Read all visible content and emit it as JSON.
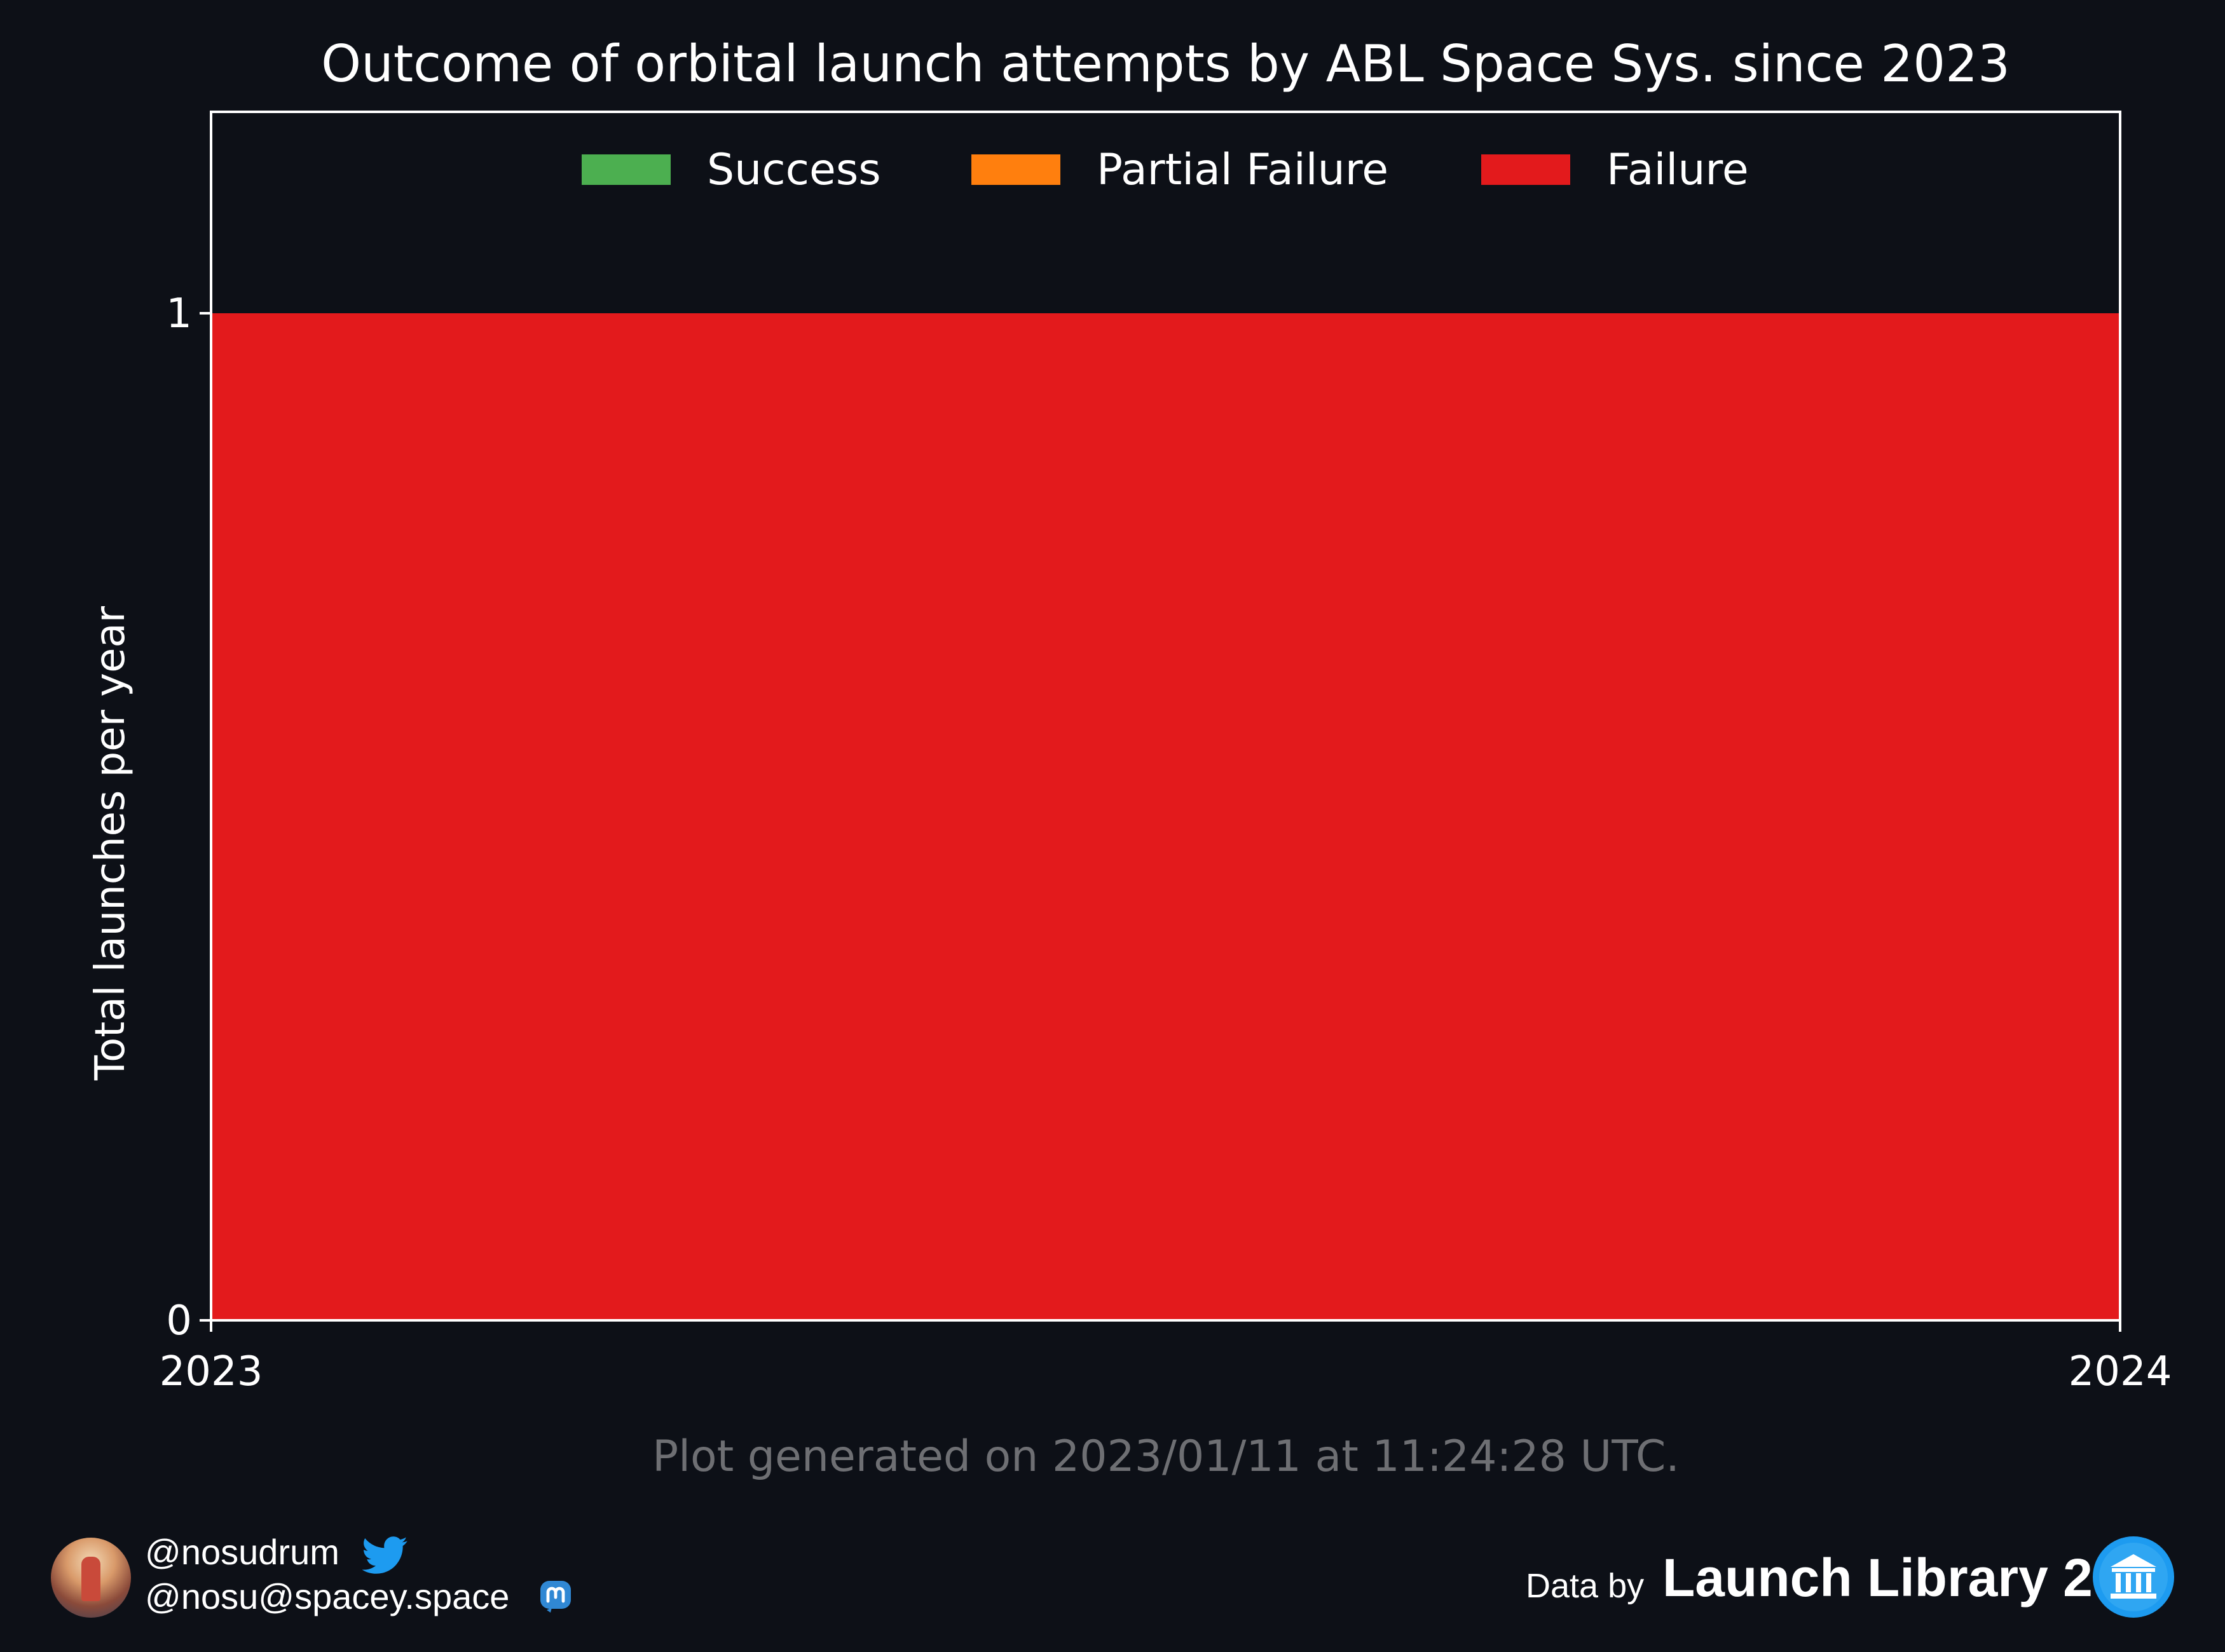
{
  "chart_data": {
    "type": "area",
    "title": "Outcome of orbital launch attempts by ABL Space Sys. since 2023",
    "ylabel": "Total launches per year",
    "xlabel": "",
    "x": [
      2023,
      2024
    ],
    "xlim": [
      2023,
      2024
    ],
    "xticks": [
      "2023",
      "2024"
    ],
    "ylim": [
      0,
      1.2
    ],
    "yticks": [
      "0",
      "1"
    ],
    "stacked": true,
    "series": [
      {
        "name": "Success",
        "values": [
          0,
          0
        ],
        "color": "#4caf50"
      },
      {
        "name": "Partial Failure",
        "values": [
          0,
          0
        ],
        "color": "#ff7f0e"
      },
      {
        "name": "Failure",
        "values": [
          1,
          1
        ],
        "color": "#e31a1c"
      }
    ],
    "legend_position": "top-center",
    "grid": false
  },
  "footer": {
    "note": "Plot generated on 2023/01/11 at 11:24:28 UTC.",
    "twitter_handle": "@nosudrum",
    "mastodon_handle": "@nosu@spacey.space",
    "credit_prefix": "Data by",
    "credit_name": "Launch Library 2"
  },
  "colors": {
    "background": "#0d1017",
    "axes": "#ffffff",
    "footer_text": "#6e6f73",
    "icon_blue": "#1d9bf0",
    "mastodon_blue": "#3088d4"
  },
  "icons": [
    "avatar",
    "twitter-icon",
    "mastodon-icon",
    "launch-library-icon"
  ]
}
